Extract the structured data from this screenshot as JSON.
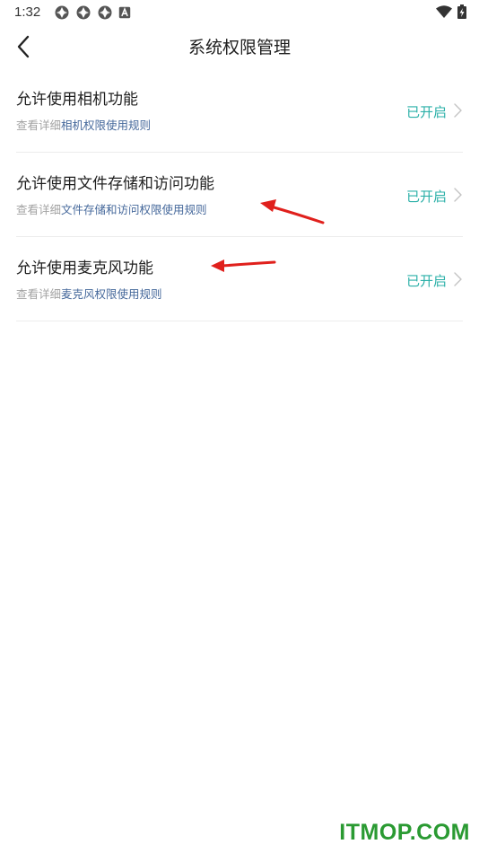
{
  "status_bar": {
    "time": "1:32",
    "left_icons": [
      "app-notification-icon",
      "app-notification-icon",
      "app-notification-icon",
      "a-badge-icon"
    ],
    "right_icons": [
      "wifi-icon",
      "battery-charging-icon"
    ]
  },
  "header": {
    "title": "系统权限管理",
    "back_icon": "chevron-left-icon"
  },
  "permissions": [
    {
      "title": "允许使用相机功能",
      "sub_prefix": "查看详细",
      "sub_link": "相机权限使用规则",
      "status": "已开启"
    },
    {
      "title": "允许使用文件存储和访问功能",
      "sub_prefix": "查看详细",
      "sub_link": "文件存储和访问权限使用规则",
      "status": "已开启"
    },
    {
      "title": "允许使用麦克风功能",
      "sub_prefix": "查看详细",
      "sub_link": "麦克风权限使用规则",
      "status": "已开启"
    }
  ],
  "watermark": "ITMOP.COM",
  "colors": {
    "status_on": "#2bb0a8",
    "link": "#45689b",
    "hint": "#a3a3a3",
    "annotation_arrow": "#e0201c",
    "watermark": "#2a9a32"
  }
}
